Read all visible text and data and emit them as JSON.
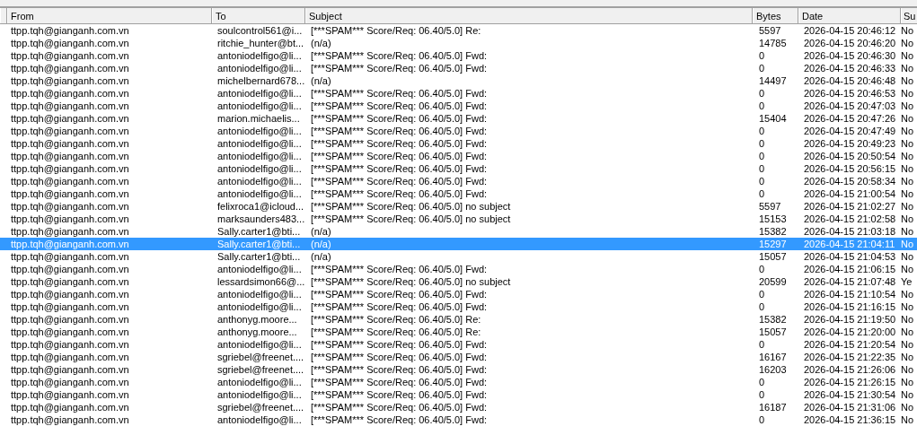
{
  "table": {
    "columns": [
      "From",
      "To",
      "Subject",
      "Bytes",
      "Date",
      "Su"
    ],
    "rows": [
      {
        "from": "ttpp.tqh@gianganh.com.vn",
        "to": "soulcontrol561@i...",
        "subject": "[***SPAM*** Score/Req: 06.40/5.0] Re:",
        "bytes": "5597",
        "date": "2026-04-15 20:46:12",
        "column_6": "No",
        "selected": false
      },
      {
        "from": "ttpp.tqh@gianganh.com.vn",
        "to": "ritchie_hunter@bt...",
        "subject": "(n/a)",
        "bytes": "14785",
        "date": "2026-04-15 20:46:20",
        "column_6": "No",
        "selected": false
      },
      {
        "from": "ttpp.tqh@gianganh.com.vn",
        "to": "antoniodelfigo@li...",
        "subject": "[***SPAM*** Score/Req: 06.40/5.0] Fwd:",
        "bytes": "0",
        "date": "2026-04-15 20:46:30",
        "column_6": "No",
        "selected": false
      },
      {
        "from": "ttpp.tqh@gianganh.com.vn",
        "to": "antoniodelfigo@li...",
        "subject": "[***SPAM*** Score/Req: 06.40/5.0] Fwd:",
        "bytes": "0",
        "date": "2026-04-15 20:46:33",
        "column_6": "No",
        "selected": false
      },
      {
        "from": "ttpp.tqh@gianganh.com.vn",
        "to": "michelbernard678...",
        "subject": "(n/a)",
        "bytes": "14497",
        "date": "2026-04-15 20:46:48",
        "column_6": "No",
        "selected": false
      },
      {
        "from": "ttpp.tqh@gianganh.com.vn",
        "to": "antoniodelfigo@li...",
        "subject": "[***SPAM*** Score/Req: 06.40/5.0] Fwd:",
        "bytes": "0",
        "date": "2026-04-15 20:46:53",
        "column_6": "No",
        "selected": false
      },
      {
        "from": "ttpp.tqh@gianganh.com.vn",
        "to": "antoniodelfigo@li...",
        "subject": "[***SPAM*** Score/Req: 06.40/5.0] Fwd:",
        "bytes": "0",
        "date": "2026-04-15 20:47:03",
        "column_6": "No",
        "selected": false
      },
      {
        "from": "ttpp.tqh@gianganh.com.vn",
        "to": "marion.michaelis...",
        "subject": "[***SPAM*** Score/Req: 06.40/5.0] Fwd:",
        "bytes": "15404",
        "date": "2026-04-15 20:47:26",
        "column_6": "No",
        "selected": false
      },
      {
        "from": "ttpp.tqh@gianganh.com.vn",
        "to": "antoniodelfigo@li...",
        "subject": "[***SPAM*** Score/Req: 06.40/5.0] Fwd:",
        "bytes": "0",
        "date": "2026-04-15 20:47:49",
        "column_6": "No",
        "selected": false
      },
      {
        "from": "ttpp.tqh@gianganh.com.vn",
        "to": "antoniodelfigo@li...",
        "subject": "[***SPAM*** Score/Req: 06.40/5.0] Fwd:",
        "bytes": "0",
        "date": "2026-04-15 20:49:23",
        "column_6": "No",
        "selected": false
      },
      {
        "from": "ttpp.tqh@gianganh.com.vn",
        "to": "antoniodelfigo@li...",
        "subject": "[***SPAM*** Score/Req: 06.40/5.0] Fwd:",
        "bytes": "0",
        "date": "2026-04-15 20:50:54",
        "column_6": "No",
        "selected": false
      },
      {
        "from": "ttpp.tqh@gianganh.com.vn",
        "to": "antoniodelfigo@li...",
        "subject": "[***SPAM*** Score/Req: 06.40/5.0] Fwd:",
        "bytes": "0",
        "date": "2026-04-15 20:56:15",
        "column_6": "No",
        "selected": false
      },
      {
        "from": "ttpp.tqh@gianganh.com.vn",
        "to": "antoniodelfigo@li...",
        "subject": "[***SPAM*** Score/Req: 06.40/5.0] Fwd:",
        "bytes": "0",
        "date": "2026-04-15 20:58:34",
        "column_6": "No",
        "selected": false
      },
      {
        "from": "ttpp.tqh@gianganh.com.vn",
        "to": "antoniodelfigo@li...",
        "subject": "[***SPAM*** Score/Req: 06.40/5.0] Fwd:",
        "bytes": "0",
        "date": "2026-04-15 21:00:54",
        "column_6": "No",
        "selected": false
      },
      {
        "from": "ttpp.tqh@gianganh.com.vn",
        "to": "felixroca1@icloud...",
        "subject": "[***SPAM*** Score/Req: 06.40/5.0] no subject",
        "bytes": "5597",
        "date": "2026-04-15 21:02:27",
        "column_6": "No",
        "selected": false
      },
      {
        "from": "ttpp.tqh@gianganh.com.vn",
        "to": "marksaunders483...",
        "subject": "[***SPAM*** Score/Req: 06.40/5.0] no subject",
        "bytes": "15153",
        "date": "2026-04-15 21:02:58",
        "column_6": "No",
        "selected": false
      },
      {
        "from": "ttpp.tqh@gianganh.com.vn",
        "to": "Sally.carter1@bti...",
        "subject": "(n/a)",
        "bytes": "15382",
        "date": "2026-04-15 21:03:18",
        "column_6": "No",
        "selected": false
      },
      {
        "from": "ttpp.tqh@gianganh.com.vn",
        "to": "Sally.carter1@bti...",
        "subject": "(n/a)",
        "bytes": "15297",
        "date": "2026-04-15 21:04:11",
        "column_6": "No",
        "selected": true
      },
      {
        "from": "ttpp.tqh@gianganh.com.vn",
        "to": "Sally.carter1@bti...",
        "subject": "(n/a)",
        "bytes": "15057",
        "date": "2026-04-15 21:04:53",
        "column_6": "No",
        "selected": false
      },
      {
        "from": "ttpp.tqh@gianganh.com.vn",
        "to": "antoniodelfigo@li...",
        "subject": "[***SPAM*** Score/Req: 06.40/5.0] Fwd:",
        "bytes": "0",
        "date": "2026-04-15 21:06:15",
        "column_6": "No",
        "selected": false
      },
      {
        "from": "ttpp.tqh@gianganh.com.vn",
        "to": "lessardsimon66@...",
        "subject": "[***SPAM*** Score/Req: 06.40/5.0] no subject",
        "bytes": "20599",
        "date": "2026-04-15 21:07:48",
        "column_6": "Ye",
        "selected": false
      },
      {
        "from": "ttpp.tqh@gianganh.com.vn",
        "to": "antoniodelfigo@li...",
        "subject": "[***SPAM*** Score/Req: 06.40/5.0] Fwd:",
        "bytes": "0",
        "date": "2026-04-15 21:10:54",
        "column_6": "No",
        "selected": false
      },
      {
        "from": "ttpp.tqh@gianganh.com.vn",
        "to": "antoniodelfigo@li...",
        "subject": "[***SPAM*** Score/Req: 06.40/5.0] Fwd:",
        "bytes": "0",
        "date": "2026-04-15 21:16:15",
        "column_6": "No",
        "selected": false
      },
      {
        "from": "ttpp.tqh@gianganh.com.vn",
        "to": "anthonyg.moore...",
        "subject": "[***SPAM*** Score/Req: 06.40/5.0] Re:",
        "bytes": "15382",
        "date": "2026-04-15 21:19:50",
        "column_6": "No",
        "selected": false
      },
      {
        "from": "ttpp.tqh@gianganh.com.vn",
        "to": "anthonyg.moore...",
        "subject": "[***SPAM*** Score/Req: 06.40/5.0] Re:",
        "bytes": "15057",
        "date": "2026-04-15 21:20:00",
        "column_6": "No",
        "selected": false
      },
      {
        "from": "ttpp.tqh@gianganh.com.vn",
        "to": "antoniodelfigo@li...",
        "subject": "[***SPAM*** Score/Req: 06.40/5.0] Fwd:",
        "bytes": "0",
        "date": "2026-04-15 21:20:54",
        "column_6": "No",
        "selected": false
      },
      {
        "from": "ttpp.tqh@gianganh.com.vn",
        "to": "sgriebel@freenet....",
        "subject": "[***SPAM*** Score/Req: 06.40/5.0] Fwd:",
        "bytes": "16167",
        "date": "2026-04-15 21:22:35",
        "column_6": "No",
        "selected": false
      },
      {
        "from": "ttpp.tqh@gianganh.com.vn",
        "to": "sgriebel@freenet....",
        "subject": "[***SPAM*** Score/Req: 06.40/5.0] Fwd:",
        "bytes": "16203",
        "date": "2026-04-15 21:26:06",
        "column_6": "No",
        "selected": false
      },
      {
        "from": "ttpp.tqh@gianganh.com.vn",
        "to": "antoniodelfigo@li...",
        "subject": "[***SPAM*** Score/Req: 06.40/5.0] Fwd:",
        "bytes": "0",
        "date": "2026-04-15 21:26:15",
        "column_6": "No",
        "selected": false
      },
      {
        "from": "ttpp.tqh@gianganh.com.vn",
        "to": "antoniodelfigo@li...",
        "subject": "[***SPAM*** Score/Req: 06.40/5.0] Fwd:",
        "bytes": "0",
        "date": "2026-04-15 21:30:54",
        "column_6": "No",
        "selected": false
      },
      {
        "from": "ttpp.tqh@gianganh.com.vn",
        "to": "sgriebel@freenet....",
        "subject": "[***SPAM*** Score/Req: 06.40/5.0] Fwd:",
        "bytes": "16187",
        "date": "2026-04-15 21:31:06",
        "column_6": "No",
        "selected": false
      },
      {
        "from": "ttpp.tqh@gianganh.com.vn",
        "to": "antoniodelfigo@li...",
        "subject": "[***SPAM*** Score/Req: 06.40/5.0] Fwd:",
        "bytes": "0",
        "date": "2026-04-15 21:36:15",
        "column_6": "No",
        "selected": false
      }
    ]
  }
}
